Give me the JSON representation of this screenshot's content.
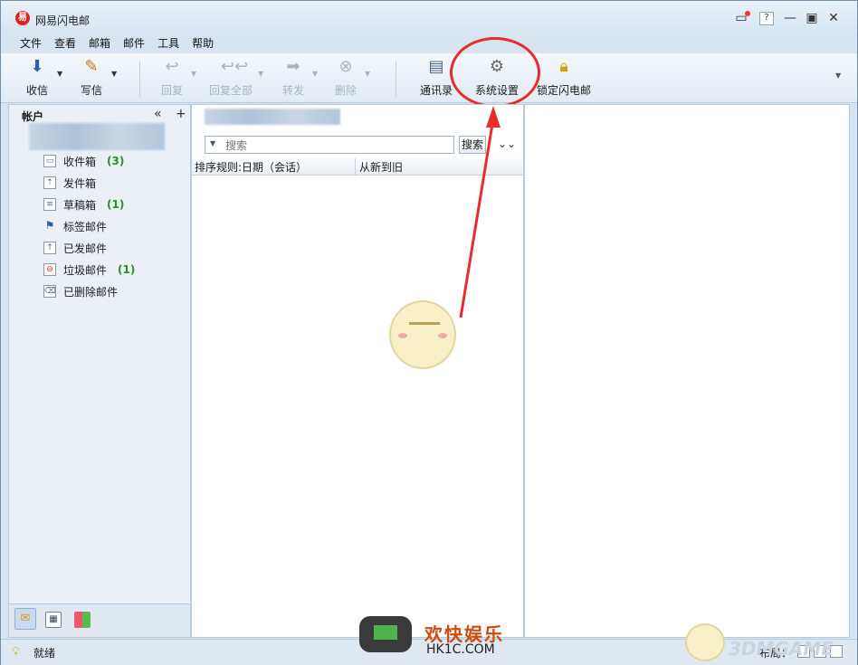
{
  "window": {
    "title": "网易闪电邮"
  },
  "menu": [
    "文件",
    "查看",
    "邮箱",
    "邮件",
    "工具",
    "帮助"
  ],
  "toolbar": {
    "receive": "收信",
    "compose": "写信",
    "reply": "回复",
    "reply_all": "回复全部",
    "forward": "转发",
    "delete": "删除",
    "contacts": "通讯录",
    "settings": "系统设置",
    "lock": "锁定闪电邮"
  },
  "sidebar": {
    "account_header": "帐户",
    "collapse_glyph": "«",
    "add_glyph": "+",
    "folders": [
      {
        "label": "收件箱",
        "count": "(3)"
      },
      {
        "label": "发件箱",
        "count": ""
      },
      {
        "label": "草稿箱",
        "count": "(1)"
      },
      {
        "label": "标签邮件",
        "count": ""
      },
      {
        "label": "已发邮件",
        "count": ""
      },
      {
        "label": "垃圾邮件",
        "count": "(1)"
      },
      {
        "label": "已删除邮件",
        "count": ""
      }
    ]
  },
  "list": {
    "search_placeholder": "搜索",
    "search_button": "搜索",
    "sort_rule": "排序规则:日期（会话）",
    "sort_order": "从新到旧"
  },
  "status": {
    "text": "就绪",
    "layout_label": "布局："
  },
  "watermark": {
    "title": "欢快娱乐",
    "site": "HK1C.COM",
    "logo": "3DMGAME"
  },
  "colors": {
    "accent_red": "#e82b2b",
    "count_green": "#2e8b2e"
  }
}
